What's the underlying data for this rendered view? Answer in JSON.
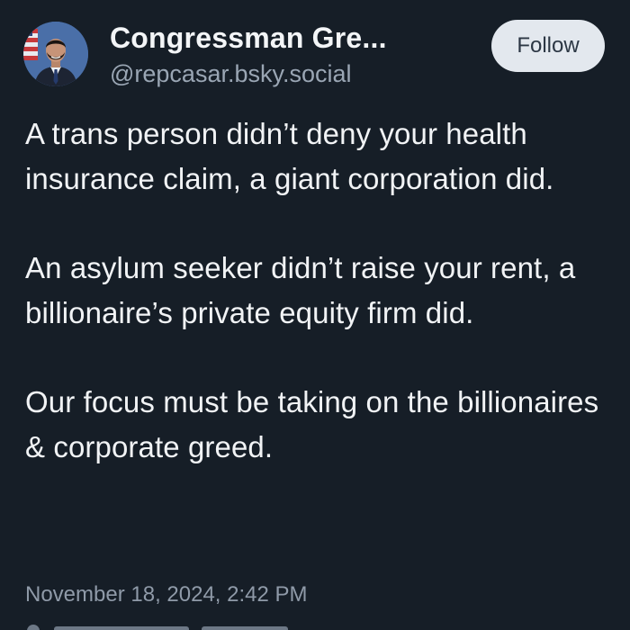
{
  "post": {
    "author": {
      "display_name": "Congressman Gre...",
      "handle": "@repcasar.bsky.social",
      "avatar_icon": "profile-photo-icon"
    },
    "follow_label": "Follow",
    "paragraphs": [
      "A trans person didn’t deny your health insurance claim, a giant corporation did.",
      "An asylum seeker didn’t raise your rent, a billionaire’s private equity firm did.",
      "Our focus must be taking on the billionaires & corporate greed."
    ],
    "timestamp": "November 18, 2024, 2:42 PM"
  },
  "colors": {
    "background": "#161e27",
    "text": "#f1f3f5",
    "secondary_text": "#9aa6b4",
    "follow_bg": "#e3e8ee",
    "follow_text": "#2c3744"
  }
}
